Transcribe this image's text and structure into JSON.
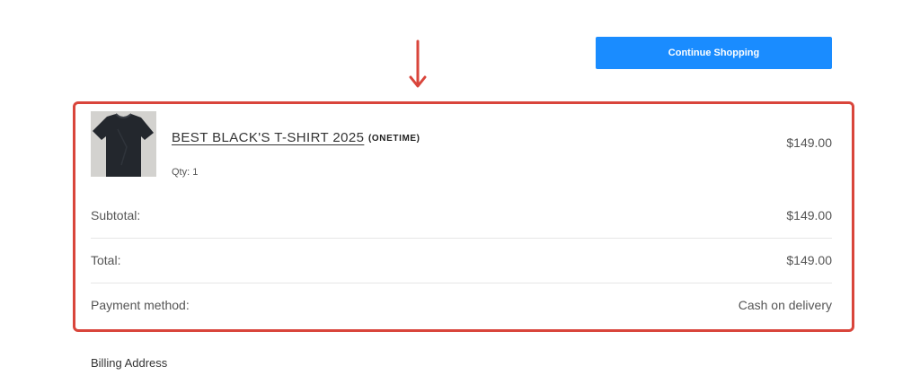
{
  "header": {
    "continue_label": "Continue Shopping"
  },
  "order": {
    "product": {
      "title": "BEST BLACK'S T-SHIRT 2025",
      "tag": "(ONETIME)",
      "qty": "Qty: 1",
      "price": "$149.00"
    },
    "subtotal": {
      "label": "Subtotal:",
      "value": "$149.00"
    },
    "total": {
      "label": "Total:",
      "value": "$149.00"
    },
    "payment": {
      "label": "Payment method:",
      "value": "Cash on delivery"
    }
  },
  "billing": {
    "heading": "Billing Address"
  },
  "colors": {
    "accent_button": "#1a8cff",
    "highlight_border": "#d9453b"
  }
}
